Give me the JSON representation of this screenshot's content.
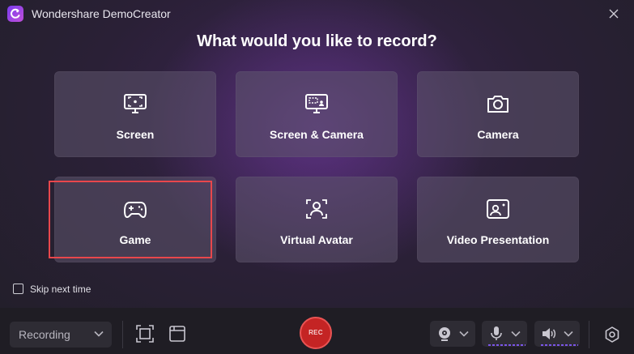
{
  "window": {
    "title": "Wondershare DemoCreator"
  },
  "heading": "What would you like to record?",
  "cards": [
    {
      "label": "Screen",
      "icon": "screen-icon"
    },
    {
      "label": "Screen & Camera",
      "icon": "screen-camera-icon"
    },
    {
      "label": "Camera",
      "icon": "camera-icon"
    },
    {
      "label": "Game",
      "icon": "gamepad-icon"
    },
    {
      "label": "Virtual Avatar",
      "icon": "avatar-icon"
    },
    {
      "label": "Video Presentation",
      "icon": "presentation-icon"
    }
  ],
  "skip_label": "Skip next time",
  "bottom": {
    "mode_value": "Recording",
    "rec_label": "REC"
  },
  "colors": {
    "highlight": "#e8474c",
    "rec": "#c42424",
    "accent": "#7b55e8"
  }
}
